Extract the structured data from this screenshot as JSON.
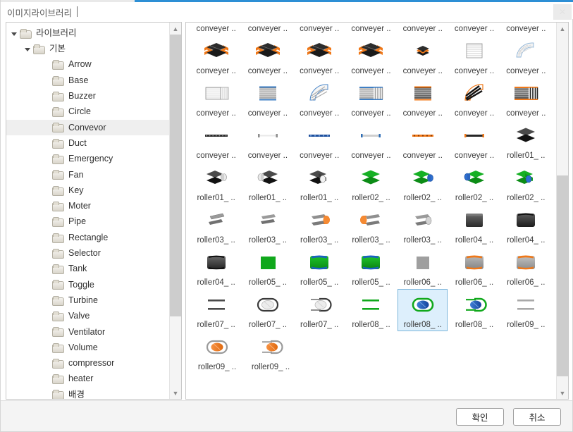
{
  "window": {
    "title": "이미지라이브러리",
    "close_label": "✕",
    "close_icon": "close-icon"
  },
  "tree": {
    "items": [
      {
        "label": "라이브러리",
        "level": 0,
        "expanded": true,
        "has_children": true,
        "selected": false
      },
      {
        "label": "기본",
        "level": 1,
        "expanded": true,
        "has_children": true,
        "selected": false
      },
      {
        "label": "Arrow",
        "level": 2,
        "expanded": false,
        "has_children": false,
        "selected": false
      },
      {
        "label": "Base",
        "level": 2,
        "expanded": false,
        "has_children": false,
        "selected": false
      },
      {
        "label": "Buzzer",
        "level": 2,
        "expanded": false,
        "has_children": false,
        "selected": false
      },
      {
        "label": "Circle",
        "level": 2,
        "expanded": false,
        "has_children": false,
        "selected": false
      },
      {
        "label": "Convevor",
        "level": 2,
        "expanded": false,
        "has_children": false,
        "selected": true
      },
      {
        "label": "Duct",
        "level": 2,
        "expanded": false,
        "has_children": false,
        "selected": false
      },
      {
        "label": "Emergency",
        "level": 2,
        "expanded": false,
        "has_children": false,
        "selected": false
      },
      {
        "label": "Fan",
        "level": 2,
        "expanded": false,
        "has_children": false,
        "selected": false
      },
      {
        "label": "Key",
        "level": 2,
        "expanded": false,
        "has_children": false,
        "selected": false
      },
      {
        "label": "Moter",
        "level": 2,
        "expanded": false,
        "has_children": false,
        "selected": false
      },
      {
        "label": "Pipe",
        "level": 2,
        "expanded": false,
        "has_children": false,
        "selected": false
      },
      {
        "label": "Rectangle",
        "level": 2,
        "expanded": false,
        "has_children": false,
        "selected": false
      },
      {
        "label": "Selector",
        "level": 2,
        "expanded": false,
        "has_children": false,
        "selected": false
      },
      {
        "label": "Tank",
        "level": 2,
        "expanded": false,
        "has_children": false,
        "selected": false
      },
      {
        "label": "Toggle",
        "level": 2,
        "expanded": false,
        "has_children": false,
        "selected": false
      },
      {
        "label": "Turbine",
        "level": 2,
        "expanded": false,
        "has_children": false,
        "selected": false
      },
      {
        "label": "Valve",
        "level": 2,
        "expanded": false,
        "has_children": false,
        "selected": false
      },
      {
        "label": "Ventilator",
        "level": 2,
        "expanded": false,
        "has_children": false,
        "selected": false
      },
      {
        "label": "Volume",
        "level": 2,
        "expanded": false,
        "has_children": false,
        "selected": false
      },
      {
        "label": "compressor",
        "level": 2,
        "expanded": false,
        "has_children": false,
        "selected": false
      },
      {
        "label": "heater",
        "level": 2,
        "expanded": false,
        "has_children": false,
        "selected": false
      },
      {
        "label": "배경",
        "level": 2,
        "expanded": false,
        "has_children": false,
        "selected": false
      }
    ],
    "scrollbar": {
      "thumb_top_pct": 0,
      "thumb_height_pct": 80
    }
  },
  "grid": {
    "scrollbar": {
      "thumb_top_pct": 40,
      "thumb_height_pct": 57
    },
    "rows": [
      [
        {
          "caption": "conveyer ..",
          "art": "blank",
          "selected": false
        },
        {
          "caption": "conveyer ..",
          "art": "blank",
          "selected": false
        },
        {
          "caption": "conveyer ..",
          "art": "blank",
          "selected": false
        },
        {
          "caption": "conveyer ..",
          "art": "blank",
          "selected": false
        },
        {
          "caption": "conveyer ..",
          "art": "blank",
          "selected": false
        },
        {
          "caption": "conveyer ..",
          "art": "blank",
          "selected": false
        },
        {
          "caption": "conveyer ..",
          "art": "blank",
          "selected": false
        }
      ],
      [
        {
          "caption": "conveyer ..",
          "art": "slab-dark",
          "selected": false
        },
        {
          "caption": "conveyer ..",
          "art": "slab-dark",
          "selected": false
        },
        {
          "caption": "conveyer ..",
          "art": "slab-dark",
          "selected": false
        },
        {
          "caption": "conveyer ..",
          "art": "slab-dark",
          "selected": false
        },
        {
          "caption": "conveyer ..",
          "art": "slab-small",
          "selected": false
        },
        {
          "caption": "conveyer ..",
          "art": "ladder-light",
          "selected": false
        },
        {
          "caption": "conveyer ..",
          "art": "curve-light",
          "selected": false
        }
      ],
      [
        {
          "caption": "conveyer ..",
          "art": "belt-pale",
          "selected": false
        },
        {
          "caption": "conveyer ..",
          "art": "belt-blue",
          "selected": false
        },
        {
          "caption": "conveyer ..",
          "art": "curve-blue",
          "selected": false
        },
        {
          "caption": "conveyer ..",
          "art": "belt-combo",
          "selected": false
        },
        {
          "caption": "conveyer ..",
          "art": "belt-orange",
          "selected": false
        },
        {
          "caption": "conveyer ..",
          "art": "curve-black",
          "selected": false
        },
        {
          "caption": "conveyer ..",
          "art": "belt-combo2",
          "selected": false
        }
      ],
      [
        {
          "caption": "conveyer ..",
          "art": "bar-dotdark",
          "selected": false
        },
        {
          "caption": "conveyer ..",
          "art": "bar-pale",
          "selected": false
        },
        {
          "caption": "conveyer ..",
          "art": "bar-dotblue",
          "selected": false
        },
        {
          "caption": "conveyer ..",
          "art": "bar-gray",
          "selected": false
        },
        {
          "caption": "conveyer ..",
          "art": "bar-dotorange",
          "selected": false
        },
        {
          "caption": "conveyer ..",
          "art": "bar-orange",
          "selected": false
        },
        {
          "caption": "roller01_ ..",
          "art": "diamond-dark",
          "selected": false
        }
      ],
      [
        {
          "caption": "roller01_ ..",
          "art": "roll-dark-r",
          "selected": false
        },
        {
          "caption": "roller01_ ..",
          "art": "roll-dark-l",
          "selected": false
        },
        {
          "caption": "roller01_ ..",
          "art": "roll-dark-c",
          "selected": false
        },
        {
          "caption": "roller02_ ..",
          "art": "diamond-green",
          "selected": false
        },
        {
          "caption": "roller02_ ..",
          "art": "roll-green-r",
          "selected": false
        },
        {
          "caption": "roller02_ ..",
          "art": "roll-green-l",
          "selected": false
        },
        {
          "caption": "roller02_ ..",
          "art": "roll-green-c",
          "selected": false
        }
      ],
      [
        {
          "caption": "roller03_ ..",
          "art": "flat-gray",
          "selected": false
        },
        {
          "caption": "roller03_ ..",
          "art": "flat-gray2",
          "selected": false
        },
        {
          "caption": "roller03_ ..",
          "art": "flat-orange-r",
          "selected": false
        },
        {
          "caption": "roller03_ ..",
          "art": "flat-orange-l",
          "selected": false
        },
        {
          "caption": "roller03_ ..",
          "art": "flat-gray3",
          "selected": false
        },
        {
          "caption": "roller04_ ..",
          "art": "box-dark",
          "selected": false
        },
        {
          "caption": "roller04_ ..",
          "art": "box-dark-cap",
          "selected": false
        }
      ],
      [
        {
          "caption": "roller04_ ..",
          "art": "box-dark-cap2",
          "selected": false
        },
        {
          "caption": "roller05_ ..",
          "art": "box-green",
          "selected": false
        },
        {
          "caption": "roller05_ ..",
          "art": "box-green-cap",
          "selected": false
        },
        {
          "caption": "roller05_ ..",
          "art": "box-green-cap2",
          "selected": false
        },
        {
          "caption": "roller06_ ..",
          "art": "box-gray",
          "selected": false
        },
        {
          "caption": "roller06_ ..",
          "art": "box-gray-cap",
          "selected": false
        },
        {
          "caption": "roller06_ ..",
          "art": "box-gray-cap2",
          "selected": false
        }
      ],
      [
        {
          "caption": "roller07_ ..",
          "art": "rails-dark",
          "selected": false
        },
        {
          "caption": "roller07_ ..",
          "art": "oval-white-o",
          "selected": false
        },
        {
          "caption": "roller07_ ..",
          "art": "oval-white",
          "selected": false
        },
        {
          "caption": "roller08_ ..",
          "art": "rails-green",
          "selected": false
        },
        {
          "caption": "roller08_ ..",
          "art": "oval-blue-o",
          "selected": true
        },
        {
          "caption": "roller08_ ..",
          "art": "oval-blue",
          "selected": false
        },
        {
          "caption": "roller09_ ..",
          "art": "rails-gray",
          "selected": false
        }
      ],
      [
        {
          "caption": "roller09_ ..",
          "art": "oval-orange-o",
          "selected": false
        },
        {
          "caption": "roller09_ ..",
          "art": "oval-orange",
          "selected": false
        }
      ]
    ]
  },
  "footer": {
    "ok_label": "확인",
    "cancel_label": "취소"
  },
  "colors": {
    "accent": "#2d8fd5",
    "selection_bg": "#ddeffc",
    "selection_border": "#7bb5db",
    "tree_selected_bg": "#efefef",
    "orange": "#f07818",
    "green": "#10a81c",
    "blue": "#1b5fc4"
  }
}
